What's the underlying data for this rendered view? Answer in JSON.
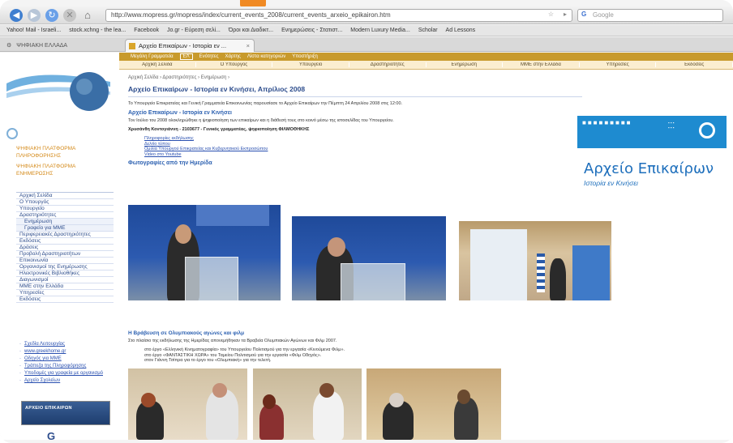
{
  "browser": {
    "url": "http://www.mopress.gr/mopress/index/current_events_2008/current_events_arxeio_epikairon.htm",
    "search_placeholder": "Google",
    "bookmarks": [
      "Yahoo! Mail - Israeli...",
      "stock.xchng - the lea...",
      "Facebook",
      "Jo.gr - Εύρεση σελί...",
      "Όροι και Διαδικτ...",
      "Ενημερώσεις - Στατιστ...",
      "Modern Luxury Media...",
      "Scholar",
      "Ad Lessons"
    ],
    "tab_home_label": "ΨΗΦΙΑΚΗ ΕΛΛΑΔΑ",
    "tab_active_label": "Αρχείο Επικαίρων - Ιστορία εν ..."
  },
  "sidebar": {
    "top_links": [
      "ΨΗΦΙΑΚΗ ΠΛΑΤΦΟΡΜΑ ΠΛΗΡΟΦΟΡΗΣΗΣ",
      "ΨΗΦΙΑΚΗ ΠΛΑΤΦΟΡΜΑ ΕΝΗΜΕΡΩΣΗΣ"
    ],
    "menu": [
      {
        "label": "Αρχική Σελίδα",
        "sub": false
      },
      {
        "label": "Ο Υπουργός",
        "sub": false
      },
      {
        "label": "Υπουργείο",
        "sub": false
      },
      {
        "label": "Δραστηριότητες",
        "sub": false
      },
      {
        "label": "Ενημέρωση",
        "sub": true
      },
      {
        "label": "Γραφείο για ΜΜΕ",
        "sub": true
      },
      {
        "label": "Περιφερειακές Δραστηριότητες",
        "sub": false
      },
      {
        "label": "Εκδόσεις",
        "sub": false
      },
      {
        "label": "Δράσεις",
        "sub": false
      },
      {
        "label": "Προβολή Δραστηριοτήτων",
        "sub": false
      },
      {
        "label": "Επικοινωνία",
        "sub": false
      },
      {
        "label": "Οργανισμοί της Ενημέρωσης",
        "sub": false
      },
      {
        "label": "Ηλεκτρονικές Βιβλιοθήκες",
        "sub": false
      },
      {
        "label": "Διαγωνισμοί",
        "sub": false
      },
      {
        "label": "ΜΜΕ στην Ελλάδα",
        "sub": false
      },
      {
        "label": "Υπηρεσίες",
        "sub": false
      },
      {
        "label": "Εκδόσεις",
        "sub": false
      }
    ],
    "bottom_links": [
      "Σχεδία Λειτουργίας",
      "www.greekhome.gr",
      "Οδηγός για ΜΜΕ",
      "Τράπεζα της Πληροφόρησης",
      "Υποδομές για γραφεία με οργανισμό",
      "Αρχείο Σχολείων"
    ],
    "banner_label": "ΑΡΧΕΙΟ ΕΠΙΚΑΙΡΩΝ",
    "bottom_logo_label": "G"
  },
  "topmenu1": {
    "items": [
      "Μεγάλη Γραμματεία",
      "ΕΛ",
      "Ενότητες",
      "Χάρτης",
      "Λίστα κατηγοριών",
      "Υποστήριξη"
    ]
  },
  "topmenu2": {
    "items": [
      "Αρχική Σελίδα",
      "Ο Υπουργός",
      "Υπουργείο",
      "Δραστηριότητες",
      "Ενημέρωση",
      "ΜΜΕ στην Ελλάδα",
      "Υπηρεσίες",
      "Εκδόσεις"
    ]
  },
  "content": {
    "breadcrumb": "Αρχική Σελίδα › Δραστηριότητες › Ενημέρωση ›",
    "title": "Αρχείο Επικαίρων - Ιστορία εν Κινήσει, Απρίλιος 2008",
    "intro": "Το Υπουργείο Επικρατείας και Γενική Γραμματεία Επικοινωνίας παρουσίασε το Αρχείο Επικαίρων την Πέμπτη 24 Απριλίου 2008 στις 12:00.",
    "heading1": "Αρχείο Επικαίρων - Ιστορία εν Κινήσει",
    "para2": "Τον Ιούλιο του 2008 ολοκληρώθηκε η ψηφιοποίηση των επικαίρων και η διάθεσή τους στο κοινό μέσω της ιστοσελίδας του Υπουργείου.",
    "contact": "Χρυσάνθη Κοντογιάννη - 2103677 - Γενικός γραμματέας, ψηφιοποίηση ΦΙΛΜΟΘΗΚΗΣ",
    "links": [
      "Πληροφορίες εκδήλωσης",
      "Δελτίο τύπου",
      "Ομιλία Υπουργού Επικρατείας και Κυβερνητικού Εκπροσώπου",
      "Video στο Youtube"
    ],
    "heading_photos": "Φωτογραφίες από την Ημερίδα",
    "section2_heading": "Η Βράβευση σε Ολυμπιακούς αγώνες και φιλμ",
    "section2_text": "Στο πλαίσιο της εκδήλωσης της Ημερίδας απονεμήθηκαν τα Βραβεία Ολυμπιακών Αγώνων και Φιλμ 2007.",
    "section2_bullets": [
      "στο έργο «Ελληνική Κινηματογραφία» του Υπουργείου Πολιτισμού για την εργασία «Κινούμενα Φιλμ».",
      "στο έργο «ΦΑΝΤΑΣΤΙΚΗ ΧΩΡΑ» του Ταμείου Πολιτισμού για την εργασία «Φιλμ Οδηγός».",
      "στον Γιάννη Τσίπρα για το έργο του «Ολυμπιακή» για την τελετή."
    ]
  },
  "logo": {
    "title": "Αρχείο Επικαίρων",
    "subtitle": "Ιστορία εν Κινήσει"
  }
}
